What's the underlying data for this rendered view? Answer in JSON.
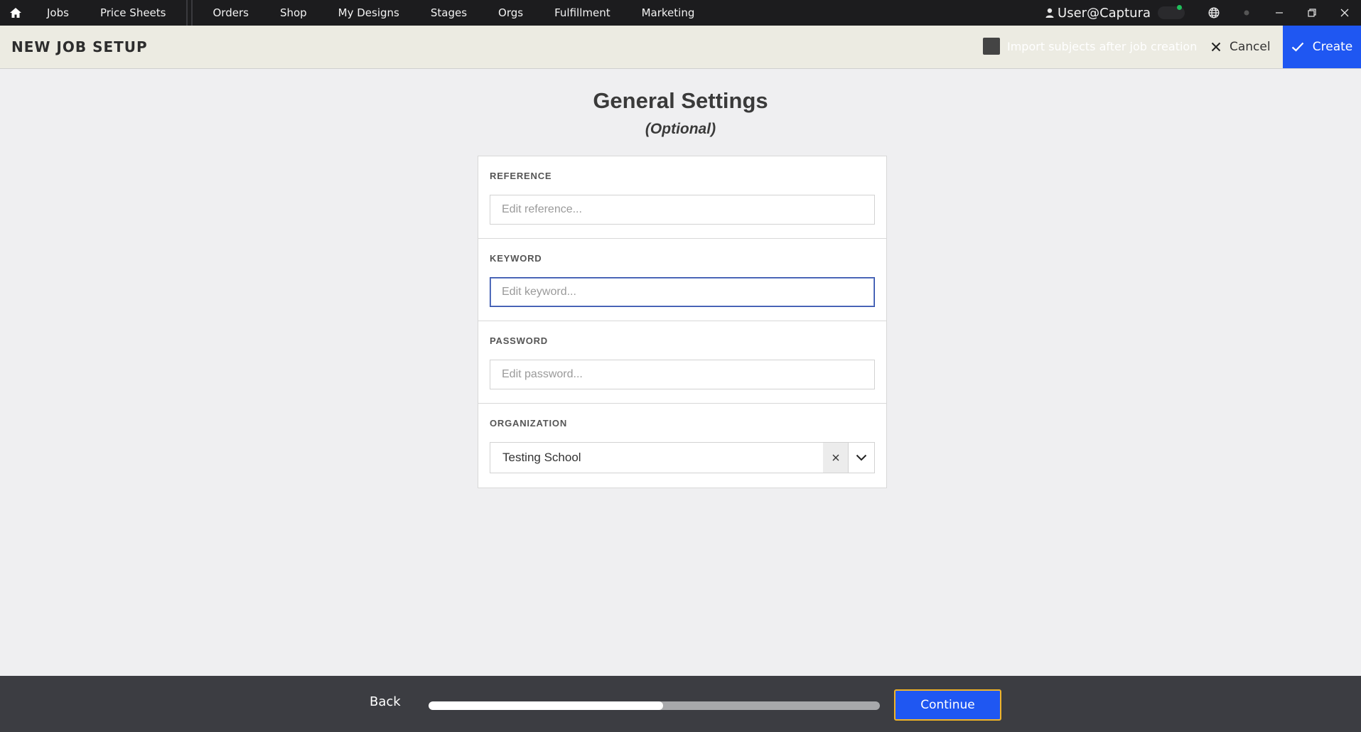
{
  "nav": {
    "items": [
      "Jobs",
      "Price Sheets",
      "Orders",
      "Shop",
      "My Designs",
      "Stages",
      "Orgs",
      "Fulfillment",
      "Marketing"
    ],
    "user": "User@Captura"
  },
  "header": {
    "title": "NEW JOB SETUP",
    "import_label": "Import subjects after job creation",
    "cancel_label": "Cancel",
    "create_label": "Create"
  },
  "main": {
    "title": "General Settings",
    "subtitle": "(Optional)",
    "reference": {
      "label": "REFERENCE",
      "placeholder": "Edit reference...",
      "value": ""
    },
    "keyword": {
      "label": "KEYWORD",
      "placeholder": "Edit keyword...",
      "value": ""
    },
    "password": {
      "label": "PASSWORD",
      "placeholder": "Edit password...",
      "value": ""
    },
    "organization": {
      "label": "ORGANIZATION",
      "value": "Testing School"
    }
  },
  "footer": {
    "back_label": "Back",
    "continue_label": "Continue",
    "progress_percent": 52
  },
  "colors": {
    "accent": "#1f57f2",
    "topbar": "#1c1c1e",
    "header_bg": "#ecebe2",
    "footer_bg": "#3c3d42",
    "focus_outline": "#f0b429",
    "status_dot": "#1fbf5a"
  },
  "icons": {
    "home": "home-icon",
    "user": "user-icon",
    "globe": "globe-icon",
    "minimize": "minimize-icon",
    "restore": "restore-icon",
    "close": "close-icon",
    "check": "check-icon",
    "chevron": "chevron-down-icon"
  }
}
